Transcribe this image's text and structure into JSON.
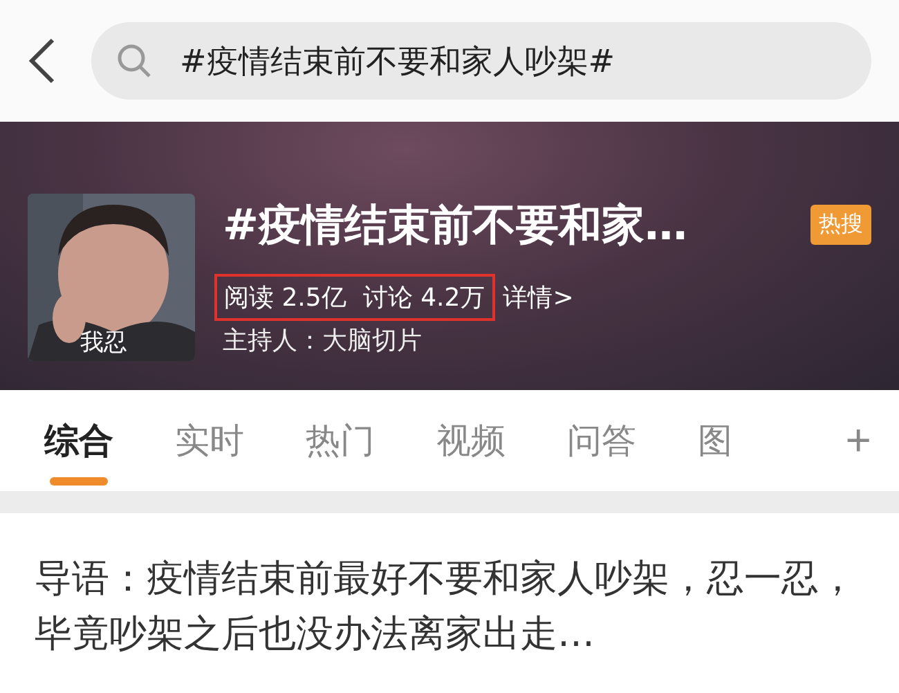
{
  "search": {
    "value": "#疫情结束前不要和家人吵架#"
  },
  "topic": {
    "title": "#疫情结束前不要和家…",
    "badge": "热搜",
    "thumb_caption": "我忍",
    "stats": {
      "highlighted": true,
      "reads": "阅读 2.5亿",
      "discussions": "讨论 4.2万"
    },
    "details_link": "详情>",
    "host": "主持人：大脑切片"
  },
  "tabs": [
    {
      "label": "综合",
      "selected": true
    },
    {
      "label": "实时",
      "selected": false
    },
    {
      "label": "热门",
      "selected": false
    },
    {
      "label": "视频",
      "selected": false
    },
    {
      "label": "问答",
      "selected": false
    },
    {
      "label": "图",
      "selected": false
    }
  ],
  "add_tab": "+",
  "intro": "导语：疫情结束前最好不要和家人吵架，忍一忍，毕竟吵架之后也没办法离家出走…"
}
